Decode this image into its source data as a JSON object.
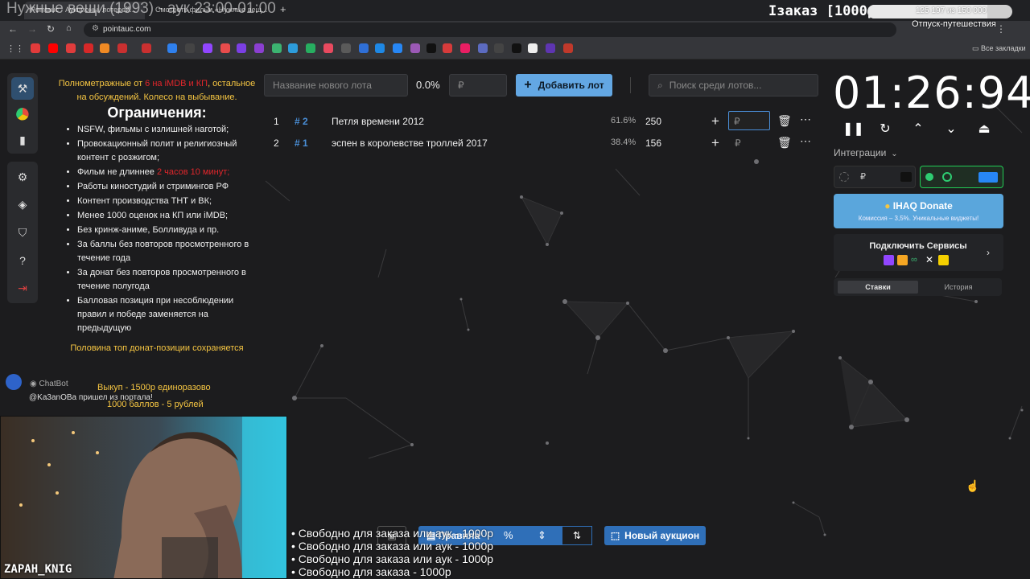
{
  "browser": {
    "tabs": [
      "Pointauc - Аукционы, лотерей...",
      "Смотреть фильм «Нужные вещ..."
    ],
    "url": "pointauc.com",
    "bookmarks_all": "Все закладки"
  },
  "stream_overlay": {
    "title": "Нужные вещи (1993) - аук 23:00-01:00",
    "order_label": "Iзаказ [1000р]",
    "progress_text": "125 197 из 150 000",
    "progress_fraction": 0.83,
    "goal_label": "Отпуск-путешествия",
    "chat_user": "ChatBot",
    "chat_message": "@Ka3anOBa пришел из портала!",
    "streamer_name": "ZAPAH_KNIG",
    "lines": [
      "• Свободно для заказа или аук - 1000р",
      "• Свободно для заказа или аук - 1000р",
      "• Свободно для заказа или аук - 1000р",
      "• Свободно для заказа - 1000р"
    ]
  },
  "rules": {
    "intro_prefix": "Полнометражные от ",
    "intro_highlight": "6 на iMDB и КП",
    "intro_suffix": ", остальное на обсуждений. Колесо на выбывание.",
    "heading": "Ограничения:",
    "items": [
      "NSFW, фильмы с излишней наготой;",
      "Провокационный полит и религиозный контент с розжигом;",
      "Работы киностудий и стримингов РФ",
      "Контент производства ТНТ и ВК;",
      "Менее 1000 оценок на КП или iMDB;",
      "Без кринж-аниме, Болливуда и пр.",
      "За баллы без повторов просмотренного в течение года",
      "За донат без повторов просмотренного в течение полугода",
      "Балловая позиция при несоблюдении правил и победе заменяется на предыдущую"
    ],
    "length_prefix": "Фильм не длиннее ",
    "length_highlight": "2 часов 10 минут;",
    "footer": [
      "Половина топ донат-позиции сохраняется",
      "Выкуп - 1500р единоразово",
      "1000 баллов - 5 рублей"
    ]
  },
  "controls": {
    "lot_name_placeholder": "Название нового лота",
    "percent": "0.0%",
    "currency": "₽",
    "add_lot": "Добавить лот",
    "search_placeholder": "Поиск среди лотов..."
  },
  "lots": [
    {
      "index": "1",
      "id": "# 2",
      "name": "Петля времени 2012",
      "percent": "61.6%",
      "amount": "250"
    },
    {
      "index": "2",
      "id": "# 1",
      "name": "эспен в королевстве троллей 2017",
      "percent": "38.4%",
      "amount": "156"
    }
  ],
  "timer": "01:26:94",
  "integrations": {
    "label": "Интеграции",
    "donate_title": "IHAQ Donate",
    "donate_sub": "Комиссия – 3,5%. Уникальные виджеты!",
    "connect_label": "Подключить Сервисы",
    "tab_bids": "Ставки",
    "tab_history": "История"
  },
  "bottom": {
    "rules": "Правила",
    "new_auction": "Новый аукцион"
  }
}
